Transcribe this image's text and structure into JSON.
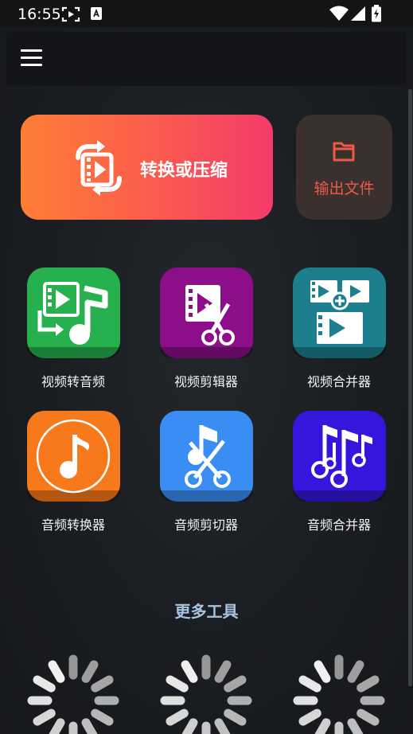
{
  "status_bar": {
    "time": "16:55",
    "icons": [
      "screen-record-icon",
      "a-notification-icon",
      "wifi-icon",
      "signal-icon",
      "battery-icon"
    ]
  },
  "app_bar": {
    "menu_icon": "hamburger-menu-icon"
  },
  "primary_actions": {
    "convert": {
      "label": "转换或压缩",
      "icon": "convert-video-icon",
      "gradient": [
        "#ff7e35",
        "#f33b6b"
      ]
    },
    "output": {
      "label": "输出文件",
      "icon": "folder-icon",
      "color": "#ef5a48"
    }
  },
  "tools": [
    {
      "label": "视频转音频",
      "icon": "video-to-audio-icon",
      "color": "#27b14e"
    },
    {
      "label": "视频剪辑器",
      "icon": "video-cutter-icon",
      "color": "#8c0e8a"
    },
    {
      "label": "视频合并器",
      "icon": "video-merger-icon",
      "color": "#1d7f8e"
    },
    {
      "label": "音频转换器",
      "icon": "audio-converter-icon",
      "color": "#f8791b"
    },
    {
      "label": "音频剪切器",
      "icon": "audio-cutter-icon",
      "color": "#3a8ef3"
    },
    {
      "label": "音频合并器",
      "icon": "audio-merger-icon",
      "color": "#3516dd"
    }
  ],
  "more_tools": {
    "label": "更多工具"
  },
  "loading_spinners": 3
}
